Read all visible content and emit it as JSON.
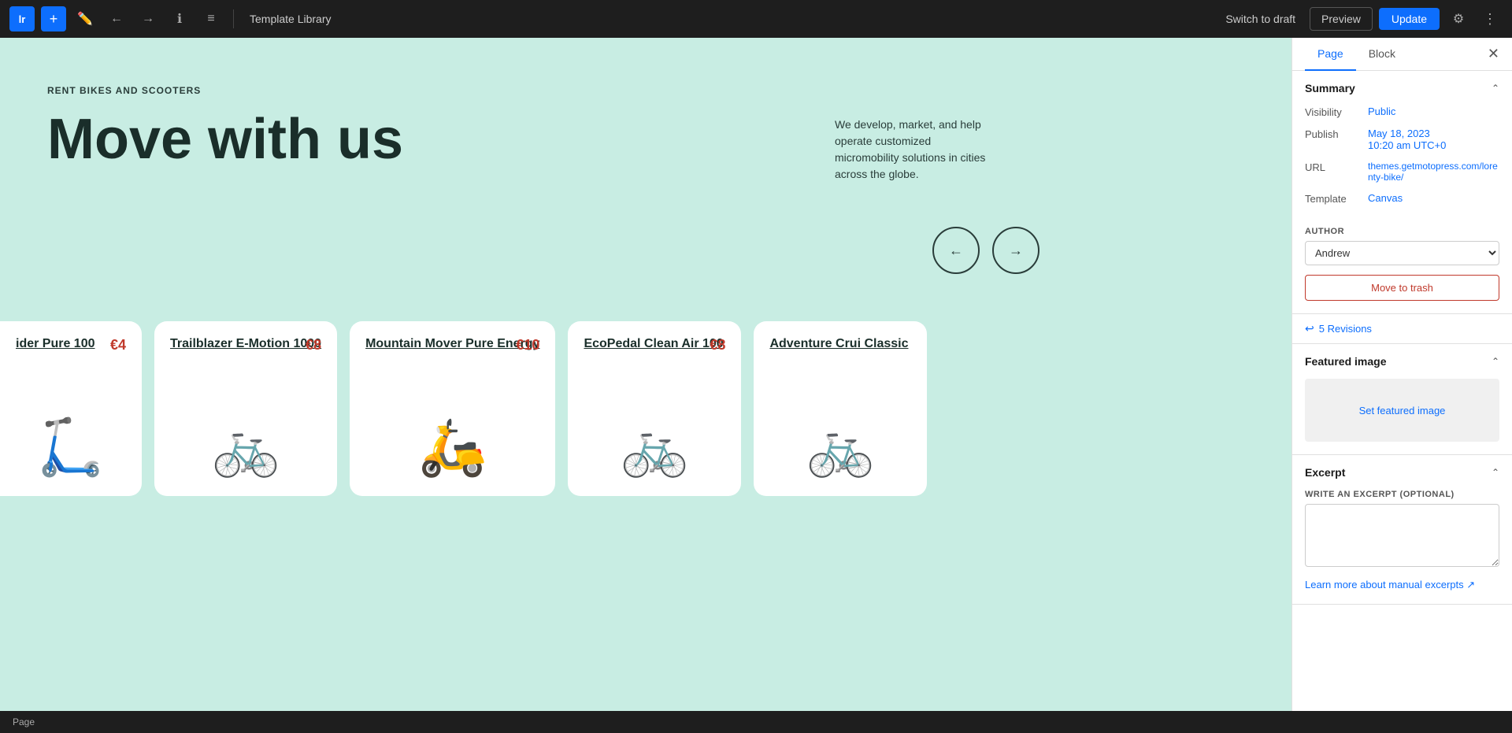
{
  "toolbar": {
    "logo": "lr",
    "add_label": "+",
    "template_library": "Template Library",
    "switch_draft_label": "Switch to draft",
    "preview_label": "Preview",
    "update_label": "Update"
  },
  "hero": {
    "subtitle": "RENT BIKES AND SCOOTERS",
    "title": "Move with us",
    "description": "We develop, market, and help operate customized micromobility solutions in cities across the globe."
  },
  "products": [
    {
      "name": "ider Pure 100",
      "price": "€4",
      "emoji": "🛴"
    },
    {
      "name": "Trailblazer E-Motion 1000",
      "price": "€8",
      "emoji": "🚲"
    },
    {
      "name": "Mountain Mover Pure Energy",
      "price": "€10",
      "emoji": "🛵"
    },
    {
      "name": "EcoPedal Clean Air 100",
      "price": "€8",
      "emoji": "🚲"
    },
    {
      "name": "Adventure Crui Classic",
      "price": "",
      "emoji": "🚲"
    }
  ],
  "sidebar": {
    "tab_page": "Page",
    "tab_block": "Block",
    "summary_title": "Summary",
    "visibility_label": "Visibility",
    "visibility_value": "Public",
    "publish_label": "Publish",
    "publish_value": "May 18, 2023\n10:20 am UTC+0",
    "publish_date": "May 18, 2023",
    "publish_time": "10:20 am UTC+0",
    "url_label": "URL",
    "url_value": "themes.getmotopress.com/lorenty-bike/",
    "template_label": "Template",
    "template_value": "Canvas",
    "author_label": "AUTHOR",
    "author_value": "Andrew",
    "author_options": [
      "Andrew"
    ],
    "trash_label": "Move to trash",
    "revisions_label": "5 Revisions",
    "featured_image_title": "Featured image",
    "set_featured_image": "Set featured image",
    "excerpt_title": "Excerpt",
    "excerpt_label": "WRITE AN EXCERPT (OPTIONAL)",
    "excerpt_link": "Learn more about manual excerpts ↗"
  },
  "statusbar": {
    "text": "Page"
  }
}
